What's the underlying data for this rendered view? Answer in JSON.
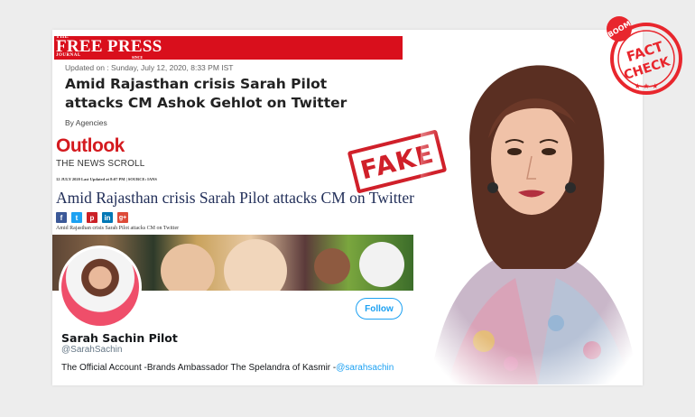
{
  "free_press": {
    "brand_the": "THE",
    "brand_name": "FREE PRESS",
    "brand_journal": "JOURNAL",
    "brand_since": "SINCE 1928",
    "updated": "Updated on : Sunday, July 12, 2020, 8:33 PM IST",
    "headline": "Amid Rajasthan crisis Sarah Pilot attacks CM Ashok Gehlot on Twitter",
    "byline": "By Agencies",
    "accent": "#d90f1c"
  },
  "outlook": {
    "logo": "Outlook",
    "section": "THE NEWS SCROLL",
    "meta": "12 JULY 2020  Last Updated at 8:07 PM | SOURCE: IANS",
    "headline": "Amid Rajasthan crisis Sarah Pilot attacks CM on Twitter",
    "share": [
      {
        "icon": "facebook-icon",
        "glyph": "f",
        "color": "#3b5998"
      },
      {
        "icon": "twitter-icon",
        "glyph": "t",
        "color": "#1da1f2"
      },
      {
        "icon": "pinterest-icon",
        "glyph": "p",
        "color": "#cb2027"
      },
      {
        "icon": "linkedin-icon",
        "glyph": "in",
        "color": "#0077b5"
      },
      {
        "icon": "google-plus-icon",
        "glyph": "g+",
        "color": "#dd4b39"
      }
    ],
    "caption": "Amid Rajasthan crisis Sarah Pilot attacks CM on Twitter"
  },
  "twitter": {
    "follow_label": "Follow",
    "name": "Sarah Sachin Pilot",
    "handle": "@SarahSachin",
    "bio_text": "The Official Account -Brands Ambassador   The Spelandra of Kasmir -",
    "bio_mention": "@sarahsachin",
    "accent": "#1da1f2"
  },
  "stamp": {
    "label": "FAKE",
    "color": "#d0202a"
  },
  "badge": {
    "brand": "BOOM",
    "line1": "FACT",
    "line2": "CHECK",
    "color": "#e8262d"
  }
}
